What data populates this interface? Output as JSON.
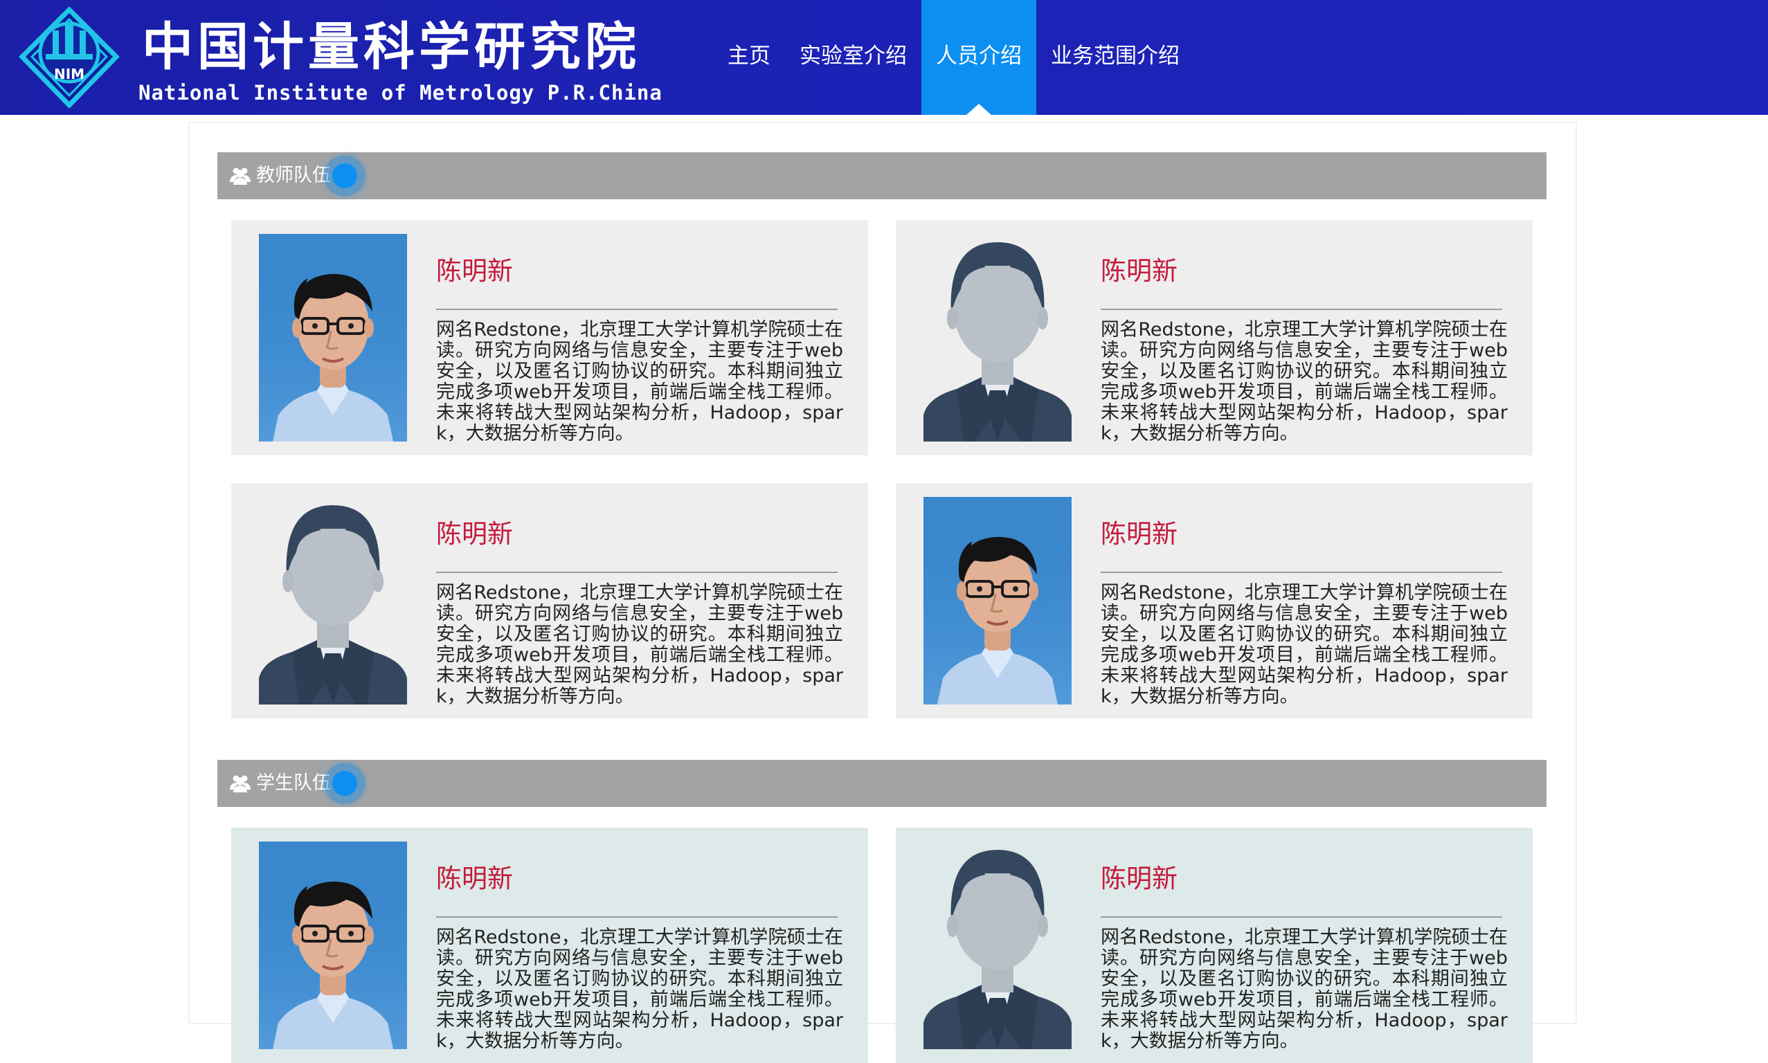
{
  "header": {
    "logo_cn": "中国计量科学研究院",
    "logo_en": "National Institute of Metrology P.R.China",
    "logo_badge": "NIM",
    "colors": {
      "bar": "#1c22b4",
      "active_tab": "#0d8ff2"
    }
  },
  "nav": {
    "items": [
      {
        "label": "主页"
      },
      {
        "label": "实验室介绍"
      },
      {
        "label": "人员介绍",
        "active": true
      },
      {
        "label": "业务范围介绍"
      }
    ]
  },
  "sections": [
    {
      "title": "教师队伍",
      "icon": "users-icon",
      "cards": [
        {
          "photo": "portrait-photo",
          "name": "陈明新",
          "desc": "网名Redstone，北京理工大学计算机学院硕士在读。研究方向网络与信息安全，主要专注于web安全，以及匿名订购协议的研究。本科期间独立完成多项web开发项目，前端后端全栈工程师。未来将转战大型网站架构分析，Hadoop，spark，大数据分析等方向。"
        },
        {
          "photo": "avatar-placeholder",
          "name": "陈明新",
          "desc": "网名Redstone，北京理工大学计算机学院硕士在读。研究方向网络与信息安全，主要专注于web安全，以及匿名订购协议的研究。本科期间独立完成多项web开发项目，前端后端全栈工程师。未来将转战大型网站架构分析，Hadoop，spark，大数据分析等方向。"
        },
        {
          "photo": "avatar-placeholder",
          "name": "陈明新",
          "desc": "网名Redstone，北京理工大学计算机学院硕士在读。研究方向网络与信息安全，主要专注于web安全，以及匿名订购协议的研究。本科期间独立完成多项web开发项目，前端后端全栈工程师。未来将转战大型网站架构分析，Hadoop，spark，大数据分析等方向。"
        },
        {
          "photo": "portrait-photo",
          "name": "陈明新",
          "desc": "网名Redstone，北京理工大学计算机学院硕士在读。研究方向网络与信息安全，主要专注于web安全，以及匿名订购协议的研究。本科期间独立完成多项web开发项目，前端后端全栈工程师。未来将转战大型网站架构分析，Hadoop，spark，大数据分析等方向。"
        }
      ]
    },
    {
      "title": "学生队伍",
      "icon": "users-icon",
      "cards": [
        {
          "photo": "portrait-photo",
          "name": "陈明新",
          "desc": "网名Redstone，北京理工大学计算机学院硕士在读。研究方向网络与信息安全，主要专注于web安全，以及匿名订购协议的研究。本科期间独立完成多项web开发项目，前端后端全栈工程师。未来将转战大型网站架构分析，Hadoop，spark，大数据分析等方向。"
        },
        {
          "photo": "avatar-placeholder",
          "name": "陈明新",
          "desc": "网名Redstone，北京理工大学计算机学院硕士在读。研究方向网络与信息安全，主要专注于web安全，以及匿名订购协议的研究。本科期间独立完成多项web开发项目，前端后端全栈工程师。未来将转战大型网站架构分析，Hadoop，spark，大数据分析等方向。"
        }
      ]
    }
  ]
}
